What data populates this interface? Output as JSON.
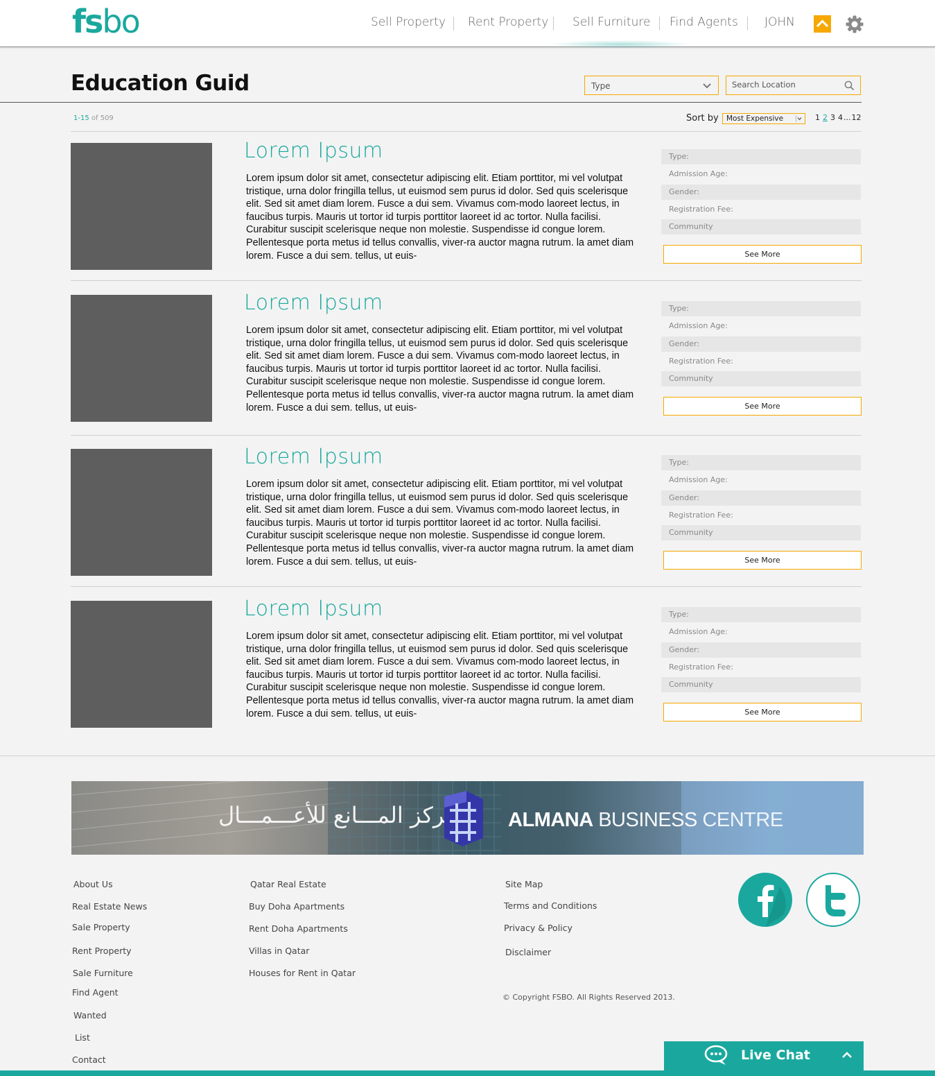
{
  "header": {
    "logo_bold": "fs",
    "logo_light": "bo",
    "nav": [
      "Sell Property",
      "Rent Property",
      "Sell Furniture",
      "Find Agents",
      "JOHN"
    ]
  },
  "toolbar": {
    "title": "Education Guid",
    "type_label": "Type",
    "search_placeholder": "Search Location",
    "count_range": "1-15",
    "count_rest": " of 509",
    "sort_label": "Sort by",
    "sort_value": "Most Expensive",
    "pages": [
      "1",
      "2",
      "3",
      "4",
      "...",
      "12"
    ],
    "active_page": "2"
  },
  "listings": [
    {
      "title": "Lorem Ipsum",
      "body": "Lorem ipsum dolor sit amet, consectetur adipiscing elit. Etiam porttitor, mi vel volutpat tristique, urna dolor fringilla tellus, ut euismod sem purus id dolor. Sed quis scelerisque elit. Sed sit amet diam lorem. Fusce a dui sem. Vivamus com-modo laoreet lectus, in faucibus turpis. Mauris ut tortor id turpis porttitor laoreet id ac tortor. Nulla facilisi. Curabitur suscipit scelerisque neque non molestie. Suspendisse id congue lorem. Pellentesque porta metus id tellus convallis, viver-ra auctor magna rutrum. la amet diam lorem. Fusce a dui sem. tellus, ut euis-",
      "attrs": [
        "Type:",
        "Admission Age:",
        "Gender:",
        "Registration Fee:",
        "Community"
      ],
      "button": "See More"
    },
    {
      "title": "Lorem Ipsum",
      "body": "Lorem ipsum dolor sit amet, consectetur adipiscing elit. Etiam porttitor, mi vel volutpat tristique, urna dolor fringilla tellus, ut euismod sem purus id dolor. Sed quis scelerisque elit. Sed sit amet diam lorem. Fusce a dui sem. Vivamus com-modo laoreet lectus, in faucibus turpis. Mauris ut tortor id turpis porttitor laoreet id ac tortor. Nulla facilisi. Curabitur suscipit scelerisque neque non molestie. Suspendisse id congue lorem. Pellentesque porta metus id tellus convallis, viver-ra auctor magna rutrum. la amet diam lorem. Fusce a dui sem. tellus, ut euis-",
      "attrs": [
        "Type:",
        "Admission Age:",
        "Gender:",
        "Registration Fee:",
        "Community"
      ],
      "button": "See More"
    },
    {
      "title": "Lorem Ipsum",
      "body": "Lorem ipsum dolor sit amet, consectetur adipiscing elit. Etiam porttitor, mi vel volutpat tristique, urna dolor fringilla tellus, ut euismod sem purus id dolor. Sed quis scelerisque elit. Sed sit amet diam lorem. Fusce a dui sem. Vivamus com-modo laoreet lectus, in faucibus turpis. Mauris ut tortor id turpis porttitor laoreet id ac tortor. Nulla facilisi. Curabitur suscipit scelerisque neque non molestie. Suspendisse id congue lorem. Pellentesque porta metus id tellus convallis, viver-ra auctor magna rutrum. la amet diam lorem. Fusce a dui sem. tellus, ut euis-",
      "attrs": [
        "Type:",
        "Admission Age:",
        "Gender:",
        "Registration Fee:",
        "Community"
      ],
      "button": "See More"
    },
    {
      "title": "Lorem Ipsum",
      "body": "Lorem ipsum dolor sit amet, consectetur adipiscing elit. Etiam porttitor, mi vel volutpat tristique, urna dolor fringilla tellus, ut euismod sem purus id dolor. Sed quis scelerisque elit. Sed sit amet diam lorem. Fusce a dui sem. Vivamus com-modo laoreet lectus, in faucibus turpis. Mauris ut tortor id turpis porttitor laoreet id ac tortor. Nulla facilisi. Curabitur suscipit scelerisque neque non molestie. Suspendisse id congue lorem. Pellentesque porta metus id tellus convallis, viver-ra auctor magna rutrum. la amet diam lorem. Fusce a dui sem. tellus, ut euis-",
      "attrs": [
        "Type:",
        "Admission Age:",
        "Gender:",
        "Registration Fee:",
        "Community"
      ],
      "button": "See More"
    }
  ],
  "banner": {
    "arabic": "مـــركز المـــانع للأعـــمـــال",
    "en_bold": "ALMANA",
    "en_mid": " BUSINESS",
    "en_end": " CENTRE"
  },
  "footer": {
    "col1": [
      "About Us",
      "Real Estate News",
      "Sale Property",
      "Rent Property",
      "Sale Furniture",
      "Find Agent",
      "Wanted",
      "List",
      "Contact"
    ],
    "col2": [
      "Qatar Real Estate",
      "Buy Doha Apartments",
      "Rent Doha Apartments",
      "Villas in Qatar",
      "Houses for Rent in Qatar"
    ],
    "col3": [
      "Site Map",
      "Terms and Conditions",
      "Privacy & Policy",
      "Disclaimer"
    ],
    "copyright": "© Copyright FSBO. All Rights Reserved 2013."
  },
  "livechat": {
    "label": "Live Chat"
  },
  "colors": {
    "brand": "#1aa89e",
    "accent": "#f6a800",
    "thumb": "#5e5e5e"
  },
  "icons": [
    "arrow-up-icon",
    "gear-icon",
    "chevron-down-icon",
    "search-icon",
    "facebook-icon",
    "twitter-icon",
    "chat-bubble-icon",
    "chevron-up-icon"
  ]
}
